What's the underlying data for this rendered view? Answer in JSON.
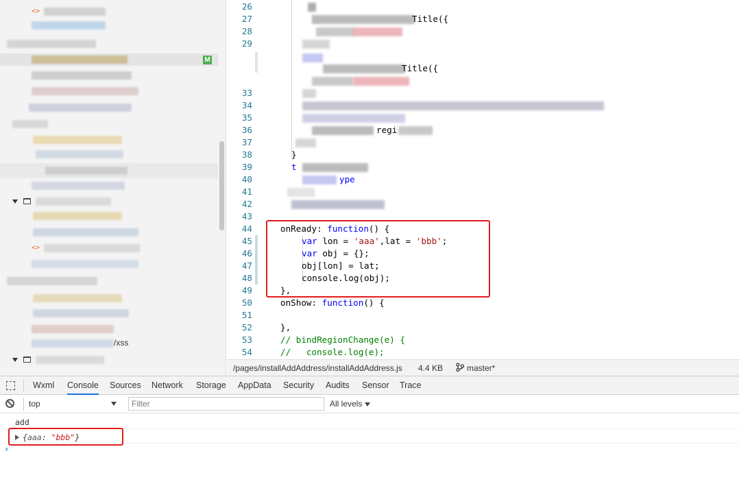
{
  "editor": {
    "line_numbers": [
      "26",
      "27",
      "28",
      "29",
      "",
      "",
      "33",
      "34",
      "35",
      "36",
      "37",
      "38",
      "39",
      "40",
      "41",
      "42",
      "43",
      "44",
      "45",
      "46",
      "47",
      "48",
      "49",
      "50",
      "51",
      "52",
      "53",
      "54"
    ],
    "lines": {
      "l27": "Title({",
      "l31": "Title({",
      "l36": "regi",
      "l38": "}",
      "l39": "t",
      "l40": "ype",
      "l44a": "onReady: ",
      "l44b": "function",
      "l44c": "() {",
      "l45a": "var",
      "l45b": " lon = ",
      "l45c": "'aaa'",
      "l45d": ",lat = ",
      "l45e": "'bbb'",
      "l45f": ";",
      "l46a": "var",
      "l46b": " obj = {};",
      "l47": "obj[lon] = lat;",
      "l48": "console.log(obj);",
      "l49": "},",
      "l50a": "onShow: ",
      "l50b": "function",
      "l50c": "() {",
      "l52": "},",
      "l53": "// bindRegionChange(e) {",
      "l54": "//   console.log(e);"
    }
  },
  "tree": {
    "badge": "M",
    "partial_text": "/xss"
  },
  "statusbar": {
    "path": "/pages/installAddAddress/installAddAddress.js",
    "size": "4.4 KB",
    "branch": "master*"
  },
  "devtools": {
    "tabs": [
      "Wxml",
      "Console",
      "Sources",
      "Network",
      "Storage",
      "AppData",
      "Security",
      "Audits",
      "Sensor",
      "Trace"
    ],
    "active_tab": "Console"
  },
  "console": {
    "context": "top",
    "filter_placeholder": "Filter",
    "levels": "All levels",
    "log_line": "add",
    "object_open": "{",
    "object_key": "aaa",
    "object_sep": ": ",
    "object_value": "\"bbb\"",
    "object_close": "}"
  },
  "colors": {
    "highlight_box": "#e31b1b",
    "keyword": "#0000ff",
    "string": "#a31515",
    "comment": "#008000",
    "line_number": "#237893"
  }
}
